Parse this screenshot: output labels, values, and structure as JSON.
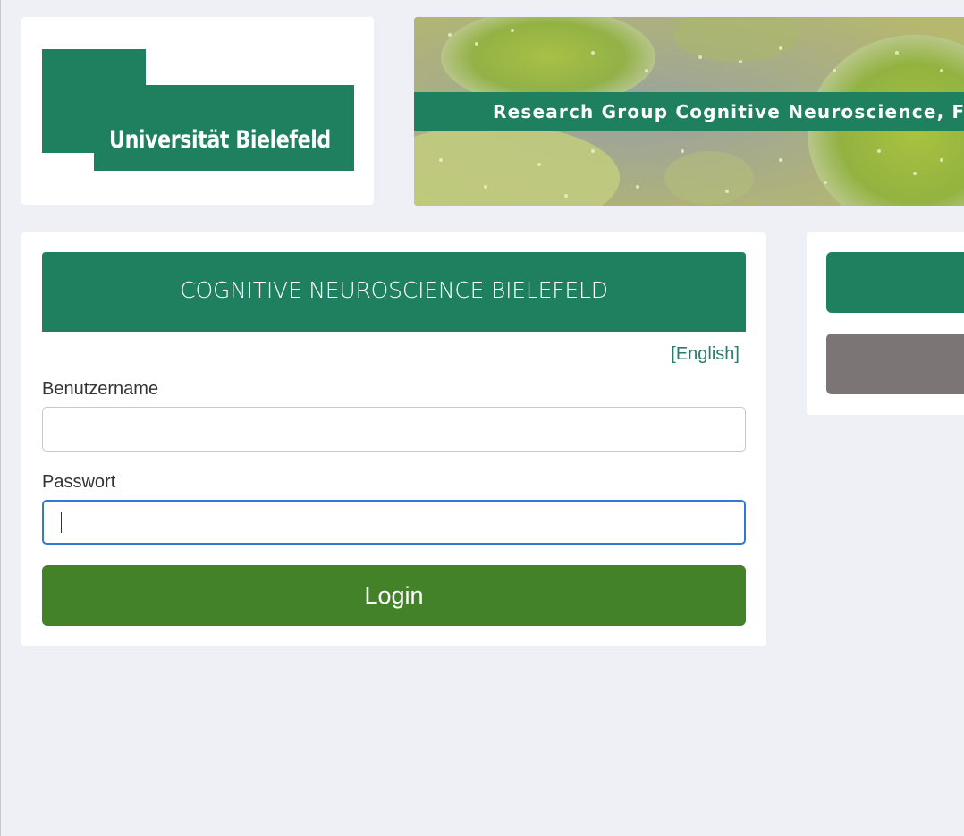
{
  "logo": {
    "text": "Universität Bielefeld"
  },
  "banner": {
    "title": "Research Group Cognitive Neuroscience, Fac"
  },
  "login": {
    "header_title": "COGNITIVE NEUROSCIENCE BIELEFELD",
    "language_link": "[English]",
    "username_label": "Benutzername",
    "username_value": "",
    "password_label": "Passwort",
    "password_value": "",
    "login_button": "Login"
  },
  "colors": {
    "brand_green": "#1f8060",
    "login_button": "#438229",
    "focus_border": "#2e78d6",
    "secondary_button": "#7c7575",
    "page_background": "#eff0f5"
  }
}
